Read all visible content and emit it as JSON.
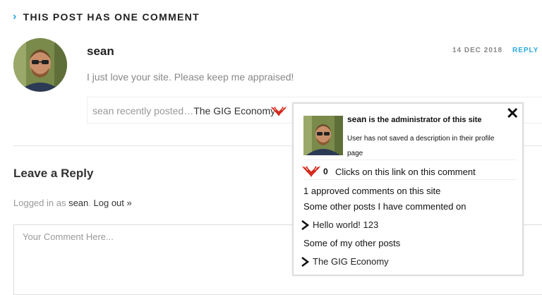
{
  "comments_section": {
    "chevron": "›",
    "title": "THIS POST HAS ONE COMMENT"
  },
  "comment": {
    "author": "sean",
    "date": "14 DEC 2018",
    "reply_label": "REPLY",
    "text": "I just love your site. Please keep me appraised!",
    "commentluv": {
      "prefix": "sean recently posted…",
      "link_text": "The GIG Economy"
    }
  },
  "reply_form": {
    "title": "Leave a Reply",
    "logged_in_prefix": "Logged in as ",
    "user": "sean",
    "separator": ". ",
    "logout_label": "Log out »",
    "textarea_placeholder": "Your Comment Here..."
  },
  "popup": {
    "close_symbol": "✕",
    "name": "sean",
    "role_text": " is the administrator of this site",
    "description": "User has not saved a description in their profile page",
    "clicks_count": "0",
    "clicks_label": "Clicks on this link on this comment",
    "approved_comments": "1 approved comments on this site",
    "other_commented_heading": "Some other posts I have commented on",
    "other_commented": [
      "Hello world! 123"
    ],
    "my_posts_heading": "Some of my other posts",
    "my_posts": [
      "The GIG Economy"
    ]
  },
  "colors": {
    "accent": "#2aa9e0",
    "heart": "#d62a1e",
    "text": "#333333",
    "muted": "#999999"
  },
  "icons": {
    "header_chevron": "chevron-right-icon",
    "commentluv": "commentluv-heart-icon",
    "close": "close-icon",
    "link_arrow": "chevron-right-icon"
  }
}
